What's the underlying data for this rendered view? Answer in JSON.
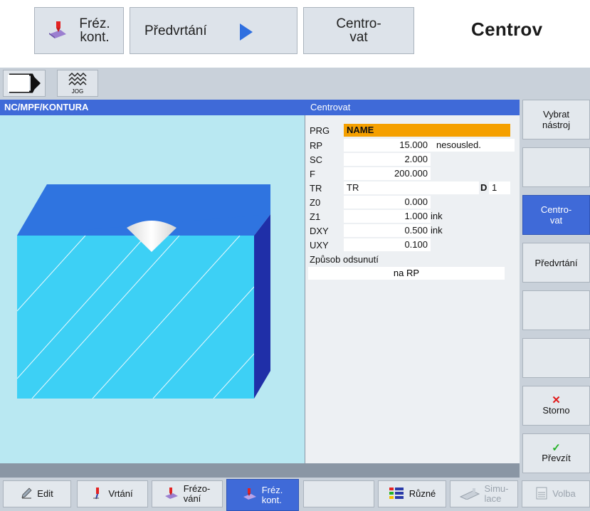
{
  "breadcrumb": {
    "item1": {
      "line1": "Fréz.",
      "line2": "kont."
    },
    "item2": {
      "label": "Předvrtání"
    },
    "item3": {
      "line1": "Centro-",
      "line2": "vat"
    }
  },
  "page_title": "Centrov",
  "mode_icon_label": "JOG",
  "path": "NC/MPF/KONTURA",
  "dialog_title": "Centrovat",
  "params": {
    "prg": {
      "label": "PRG",
      "value": "NAME"
    },
    "rp": {
      "label": "RP",
      "value": "15.000",
      "mode": "nesousled."
    },
    "sc": {
      "label": "SC",
      "value": "2.000"
    },
    "f": {
      "label": "F",
      "value": "200.000"
    },
    "tr": {
      "label": "TR",
      "value": "TR",
      "d_label": "D",
      "d_value": "1"
    },
    "z0": {
      "label": "Z0",
      "value": "0.000"
    },
    "z1": {
      "label": "Z1",
      "value": "1.000",
      "unit": "ink"
    },
    "dxy": {
      "label": "DXY",
      "value": "0.500",
      "unit": "ink"
    },
    "uxy": {
      "label": "UXY",
      "value": "0.100"
    },
    "retract": {
      "label": "Způsob odsunutí",
      "value": "na RP"
    }
  },
  "vertical_softkeys": {
    "vybrat": {
      "line1": "Vybrat",
      "line2": "nástroj"
    },
    "centrovat": {
      "line1": "Centro-",
      "line2": "vat"
    },
    "predvrtani": {
      "label": "Předvrtání"
    },
    "storno": {
      "label": "Storno"
    },
    "prevzit": {
      "label": "Převzít"
    }
  },
  "horizontal_softkeys": {
    "edit": "Edit",
    "vrtani": "Vrtání",
    "frezovani": {
      "line1": "Frézo-",
      "line2": "vání"
    },
    "frez_kont": {
      "line1": "Fréz.",
      "line2": "kont."
    },
    "ruzne": "Různé",
    "simulace": {
      "line1": "Simu-",
      "line2": "lace"
    },
    "volba": "Volba"
  },
  "colors": {
    "accent": "#3f6ad8",
    "highlight": "#f5a000",
    "workpiece_top": "#2f74e0",
    "workpiece_front": "#3dd0f5",
    "workpiece_side": "#1f2fa8"
  }
}
